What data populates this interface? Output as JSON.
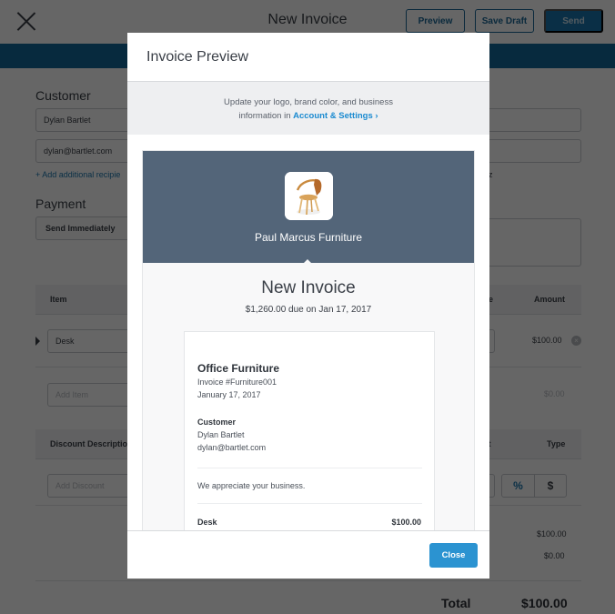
{
  "topbar": {
    "title": "New Invoice",
    "close_icon": "close-x-icon",
    "buttons": {
      "preview": "Preview",
      "save_draft": "Save Draft",
      "send": "Send"
    }
  },
  "form": {
    "customer": {
      "label": "Customer",
      "name_value": "Dylan Bartlet",
      "email_value": "dylan@bartlet.com",
      "add_recipient_link": "+ Add additional recipie",
      "right_partial_text": "z"
    },
    "payment": {
      "label": "Payment",
      "select_value": "Send Immediately"
    },
    "items_table": {
      "headers": {
        "item": "Item",
        "price_partial": "e",
        "amount": "Amount"
      },
      "rows": [
        {
          "item": "Desk",
          "amount": "$100.00"
        }
      ],
      "add_item_placeholder": "Add Item",
      "add_item_amount": "$0.00"
    },
    "discount_table": {
      "headers": {
        "description": "Discount Descriptio",
        "amount_partial": "nt",
        "type": "Type"
      },
      "add_discount_placeholder": "Add Discount",
      "type_options": [
        "%",
        "$"
      ],
      "selected_type": "%"
    },
    "summary": {
      "subtotal": "$100.00",
      "discount": "$0.00",
      "total_label": "Total",
      "total_value": "$100.00"
    }
  },
  "modal": {
    "title": "Invoice Preview",
    "notice_line1": "Update your logo, brand color, and business",
    "notice_line2_prefix": "information in ",
    "notice_link": "Account & Settings ›",
    "brand": {
      "name": "Paul Marcus Furniture",
      "logo": "chair-logo-image",
      "color": "#536579"
    },
    "invoice": {
      "heading": "New Invoice",
      "due_line": "$1,260.00 due on Jan 17, 2017",
      "title": "Office Furniture",
      "number": "Invoice #Furniture001",
      "date": "January 17, 2017",
      "customer_label": "Customer",
      "customer_name": "Dylan Bartlet",
      "customer_email": "dylan@bartlet.com",
      "message": "We appreciate your business.",
      "line_items": [
        {
          "name": "Desk",
          "price": "$100.00"
        }
      ]
    },
    "close_button": "Close",
    "accent_color": "#2b93d1"
  }
}
